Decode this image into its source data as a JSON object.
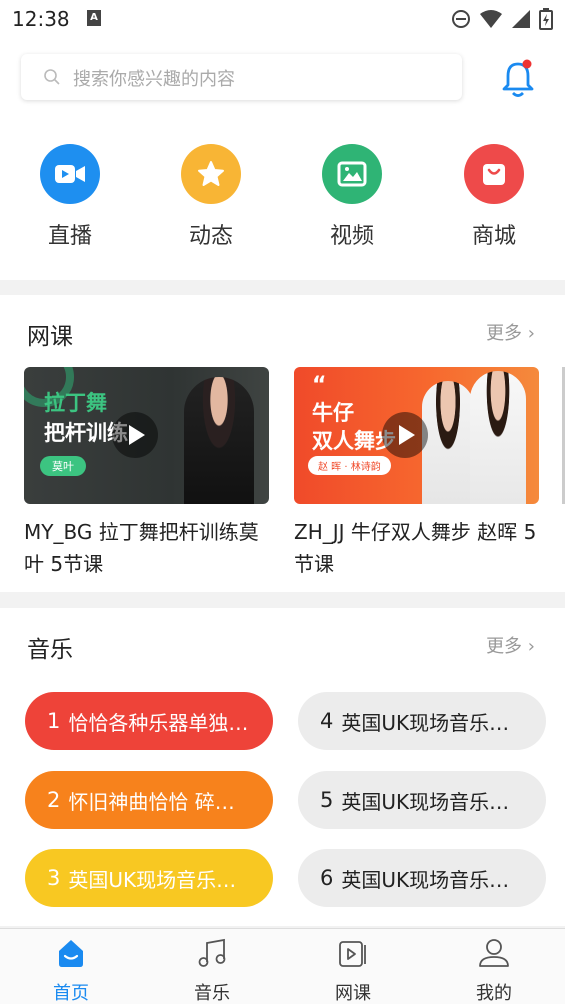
{
  "status_bar": {
    "time": "12:38"
  },
  "search": {
    "placeholder": "搜索你感兴趣的内容"
  },
  "quick_links": [
    {
      "label": "直播",
      "icon": "video-camera-icon",
      "color": "#1e8ff0"
    },
    {
      "label": "动态",
      "icon": "star-icon",
      "color": "#f8b535"
    },
    {
      "label": "视频",
      "icon": "image-icon",
      "color": "#2fb475"
    },
    {
      "label": "商城",
      "icon": "shopping-bag-icon",
      "color": "#ee4a4a"
    }
  ],
  "courses_section": {
    "title": "网课",
    "more": "更多",
    "items": [
      {
        "title": "MY_BG 拉丁舞把杆训练莫叶 5节课",
        "thumb_line1": "拉丁舞",
        "thumb_line2": "把杆训练",
        "thumb_tag": "莫叶"
      },
      {
        "title": "ZH_JJ 牛仔双人舞步 赵晖 5节课",
        "thumb_line1": "牛仔",
        "thumb_line2": "双人舞步",
        "thumb_tag": "赵 晖 · 林诗韵"
      }
    ]
  },
  "music_section": {
    "title": "音乐",
    "more": "更多",
    "items": [
      {
        "num": "1",
        "text": "恰恰各种乐器单独…",
        "color": "#ee4339"
      },
      {
        "num": "2",
        "text": "怀旧神曲恰恰 碎…",
        "color": "#f7821c"
      },
      {
        "num": "3",
        "text": "英国UK现场音乐…",
        "color": "#f8c822"
      },
      {
        "num": "4",
        "text": "英国UK现场音乐…",
        "color": "#ececec"
      },
      {
        "num": "5",
        "text": "英国UK现场音乐…",
        "color": "#ececec"
      },
      {
        "num": "6",
        "text": "英国UK现场音乐…",
        "color": "#ececec"
      }
    ]
  },
  "tabs": [
    {
      "label": "首页",
      "icon": "home-icon",
      "active": true
    },
    {
      "label": "音乐",
      "icon": "music-note-icon",
      "active": false
    },
    {
      "label": "网课",
      "icon": "video-library-icon",
      "active": false
    },
    {
      "label": "我的",
      "icon": "person-icon",
      "active": false
    }
  ],
  "colors": {
    "accent": "#1a8af0",
    "notification_dot": "#ee3333"
  }
}
